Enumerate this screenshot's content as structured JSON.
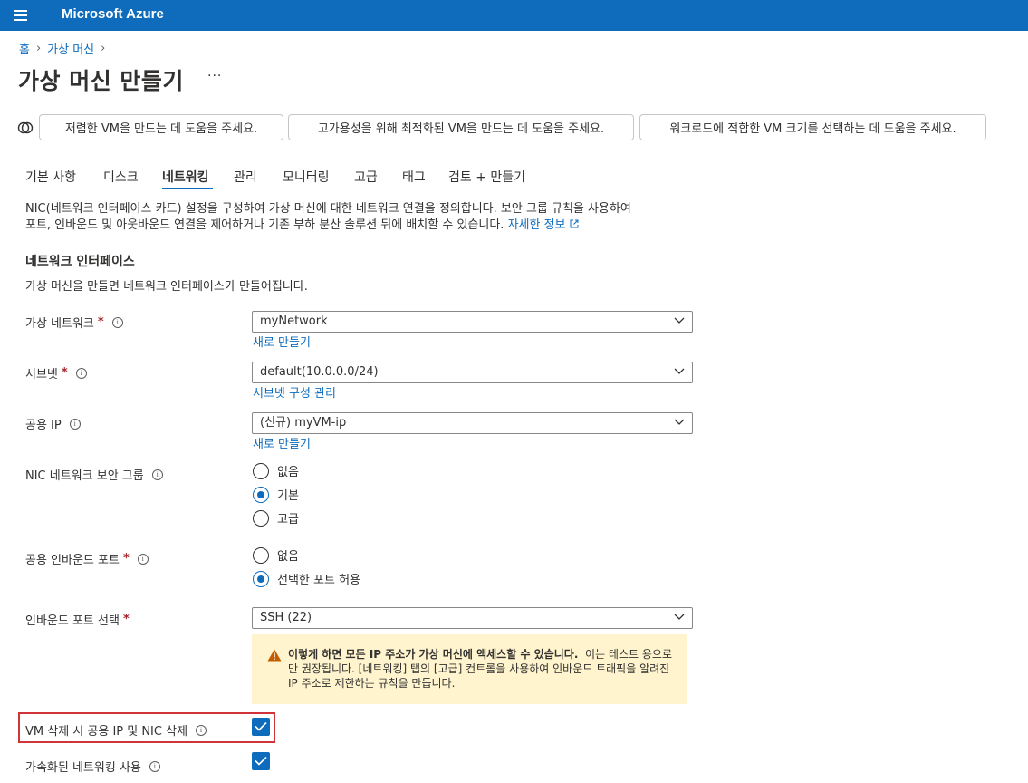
{
  "app": {
    "brand": "Microsoft Azure"
  },
  "breadcrumb": {
    "home": "홈",
    "vm": "가상 머신"
  },
  "page": {
    "title": "가상 머신 만들기",
    "more": "···"
  },
  "assist": [
    "저렴한 VM을 만드는 데 도움을 주세요.",
    "고가용성을 위해 최적화된 VM을 만드는 데 도움을 주세요.",
    "워크로드에 적합한 VM 크기를 선택하는 데 도움을 주세요."
  ],
  "tabs": [
    "기본 사항",
    "디스크",
    "네트워킹",
    "관리",
    "모니터링",
    "고급",
    "태그",
    "검토 + 만들기"
  ],
  "active_tab": "네트워킹",
  "description": {
    "line1": "NIC(네트워크 인터페이스 카드) 설정을 구성하여 가상 머신에 대한 네트워크 연결을 정의합니다. 보안 그룹 규칙을 사용하여",
    "line2": "포트, 인바운드 및 아웃바운드 연결을 제어하거나 기존 부하 분산 솔루션 뒤에 배치할 수 있습니다.",
    "link": "자세한 정보"
  },
  "section": {
    "title": "네트워크 인터페이스",
    "subtitle": "가상 머신을 만들면 네트워크 인터페이스가 만들어집니다."
  },
  "fields": {
    "vnet": {
      "label": "가상 네트워크",
      "value": "myNetwork",
      "link": "새로 만들기"
    },
    "subnet": {
      "label": "서브넷",
      "value": "default(10.0.0.0/24)",
      "link": "서브넷 구성 관리"
    },
    "public_ip": {
      "label": "공용 IP",
      "value": "(신규) myVM-ip",
      "link": "새로 만들기"
    },
    "nsg": {
      "label": "NIC 네트워크 보안 그룹",
      "options": [
        "없음",
        "기본",
        "고급"
      ],
      "selected": "기본"
    },
    "inbound": {
      "label": "공용 인바운드 포트",
      "options": [
        "없음",
        "선택한 포트 허용"
      ],
      "selected": "선택한 포트 허용"
    },
    "port_select": {
      "label": "인바운드 포트 선택",
      "value": "SSH (22)"
    },
    "delete_ip": {
      "label": "VM 삭제 시 공용 IP 및 NIC 삭제",
      "checked": true
    },
    "accel": {
      "label": "가속화된 네트워킹 사용",
      "checked": true
    }
  },
  "warning": {
    "bold": "이렇게 하면 모든 IP 주소가 가상 머신에 액세스할 수 있습니다.",
    "text": "이는 테스트 용으로만 권장됩니다. [네트워킹] 탭의 [고급] 컨트롤을 사용하여 인바운드 트래픽을 알려진 IP 주소로 제한하는 규칙을 만듭니다."
  },
  "colors": {
    "accent": "#0f6cbd",
    "required": "#a4262c",
    "warning_bg": "#fff4ce",
    "highlight": "#d13438"
  }
}
